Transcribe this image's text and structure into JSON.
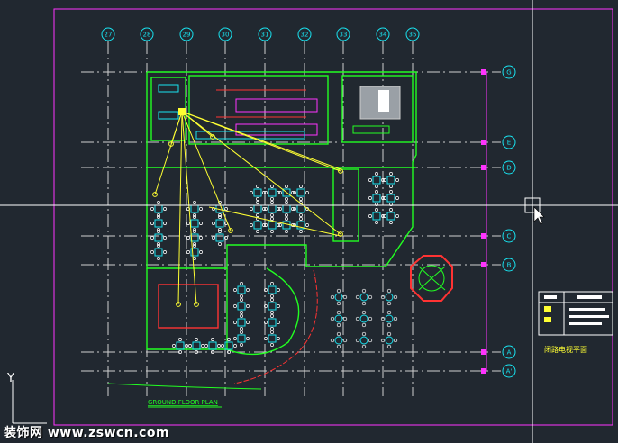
{
  "columns": [
    "27",
    "28",
    "29",
    "30",
    "31",
    "32",
    "33",
    "34",
    "35"
  ],
  "rows": [
    "G",
    "E",
    "D",
    "C",
    "B",
    "A",
    "A'"
  ],
  "plan_title": "GROUND FLOOR PLAN",
  "legend_title": "闭路电视平面",
  "watermark": "装饰网 www.zswcn.com",
  "ucs_axis_label": "Y",
  "colors": {
    "background": "#212830",
    "walls": "#22ff22",
    "grid_tags": "#19e3f0",
    "sight_lines": "#ffff33",
    "border": "#ff33ff",
    "furniture": "#19e3f0"
  },
  "icons": {
    "crosshair": "crosshair-cursor-icon",
    "arrow": "mouse-pointer-icon",
    "ucs": "ucs-axis-icon"
  }
}
